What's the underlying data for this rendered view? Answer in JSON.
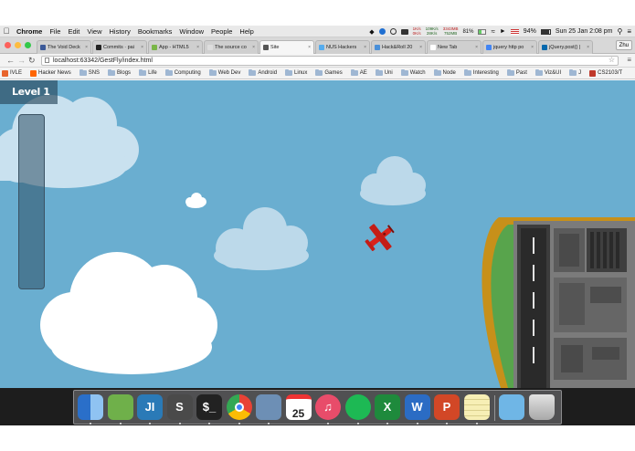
{
  "menubar": {
    "apple": "",
    "items": [
      "Chrome",
      "File",
      "Edit",
      "View",
      "History",
      "Bookmarks",
      "Window",
      "People",
      "Help"
    ],
    "status": {
      "net_up": "1K/s",
      "net_down": "0K/s",
      "traffic_up": "109K/s",
      "traffic_down": "28K/s",
      "memory_used": "3343MB",
      "memory_free": "752MB",
      "cpu": "81%",
      "battery": "94%",
      "clock": "Sun 25 Jan  2:08 pm"
    }
  },
  "tabs": [
    {
      "label": "The Void Deck",
      "color": "#3b5998"
    },
    {
      "label": "Commits · pai",
      "color": "#222222"
    },
    {
      "label": "App - HTML5",
      "color": "#7ab648"
    },
    {
      "label": "The source co",
      "color": "#dddddd"
    },
    {
      "label": "Site",
      "color": "#555555",
      "active": true
    },
    {
      "label": "NUS Hackers",
      "color": "#55acee"
    },
    {
      "label": "Hack&Roll 20",
      "color": "#4a90d9"
    },
    {
      "label": "New Tab",
      "color": "#ffffff"
    },
    {
      "label": "jquery http po",
      "color": "#4285f4"
    },
    {
      "label": "jQuery.post() |",
      "color": "#0769ad"
    }
  ],
  "profile_name": "Zhu",
  "address": {
    "url": "localhost:63342/GestFly/index.html"
  },
  "bookmarks": [
    {
      "label": "IVLE",
      "kind": "site",
      "color": "#e8642c"
    },
    {
      "label": "Hacker News",
      "kind": "site",
      "color": "#ff6600"
    },
    {
      "label": "SNS",
      "kind": "folder"
    },
    {
      "label": "Blogs",
      "kind": "folder"
    },
    {
      "label": "Life",
      "kind": "folder"
    },
    {
      "label": "Computing",
      "kind": "folder"
    },
    {
      "label": "Web Dev",
      "kind": "folder"
    },
    {
      "label": "Android",
      "kind": "folder"
    },
    {
      "label": "Linux",
      "kind": "folder"
    },
    {
      "label": "Games",
      "kind": "folder"
    },
    {
      "label": "AE",
      "kind": "folder"
    },
    {
      "label": "Uni",
      "kind": "folder"
    },
    {
      "label": "Watch",
      "kind": "folder"
    },
    {
      "label": "Node",
      "kind": "folder"
    },
    {
      "label": "Interesting",
      "kind": "folder"
    },
    {
      "label": "Past",
      "kind": "folder"
    },
    {
      "label": "Viz&UI",
      "kind": "folder"
    },
    {
      "label": "J",
      "kind": "folder"
    },
    {
      "label": "CS2103/T",
      "kind": "site",
      "color": "#c0392b"
    }
  ],
  "game": {
    "level_label": "Level 1",
    "sky_color": "#6aaed0",
    "plane_color": "#d9231c"
  },
  "dock": {
    "calendar_day": "25",
    "apps": [
      {
        "name": "finder-icon",
        "color": "#4a90d9",
        "glyph": ""
      },
      {
        "name": "android-studio-icon",
        "color": "#6fb04a",
        "glyph": ""
      },
      {
        "name": "intellij-icon",
        "color": "#2a7ab7",
        "glyph": "JI"
      },
      {
        "name": "sublime-text-icon",
        "color": "#4a4a4a",
        "glyph": "S"
      },
      {
        "name": "terminal-icon",
        "color": "#222222",
        "glyph": "$_"
      },
      {
        "name": "chrome-icon",
        "color": "#e94235",
        "glyph": ""
      },
      {
        "name": "preview-icon",
        "color": "#6d8fb5",
        "glyph": ""
      },
      {
        "name": "calendar-icon",
        "color": "#ffffff",
        "glyph": ""
      },
      {
        "name": "itunes-icon",
        "color": "#e84c6a",
        "glyph": "♫"
      },
      {
        "name": "spotify-icon",
        "color": "#1db954",
        "glyph": ""
      },
      {
        "name": "excel-icon",
        "color": "#1e8a3c",
        "glyph": "X"
      },
      {
        "name": "word-icon",
        "color": "#2b6cc4",
        "glyph": "W"
      },
      {
        "name": "powerpoint-icon",
        "color": "#d24726",
        "glyph": "P"
      },
      {
        "name": "notes-icon",
        "color": "#f7efb5",
        "glyph": ""
      },
      {
        "name": "downloads-folder-icon",
        "color": "#6fb6e6",
        "glyph": ""
      },
      {
        "name": "trash-icon",
        "color": "#c9c9c9",
        "glyph": ""
      }
    ]
  }
}
